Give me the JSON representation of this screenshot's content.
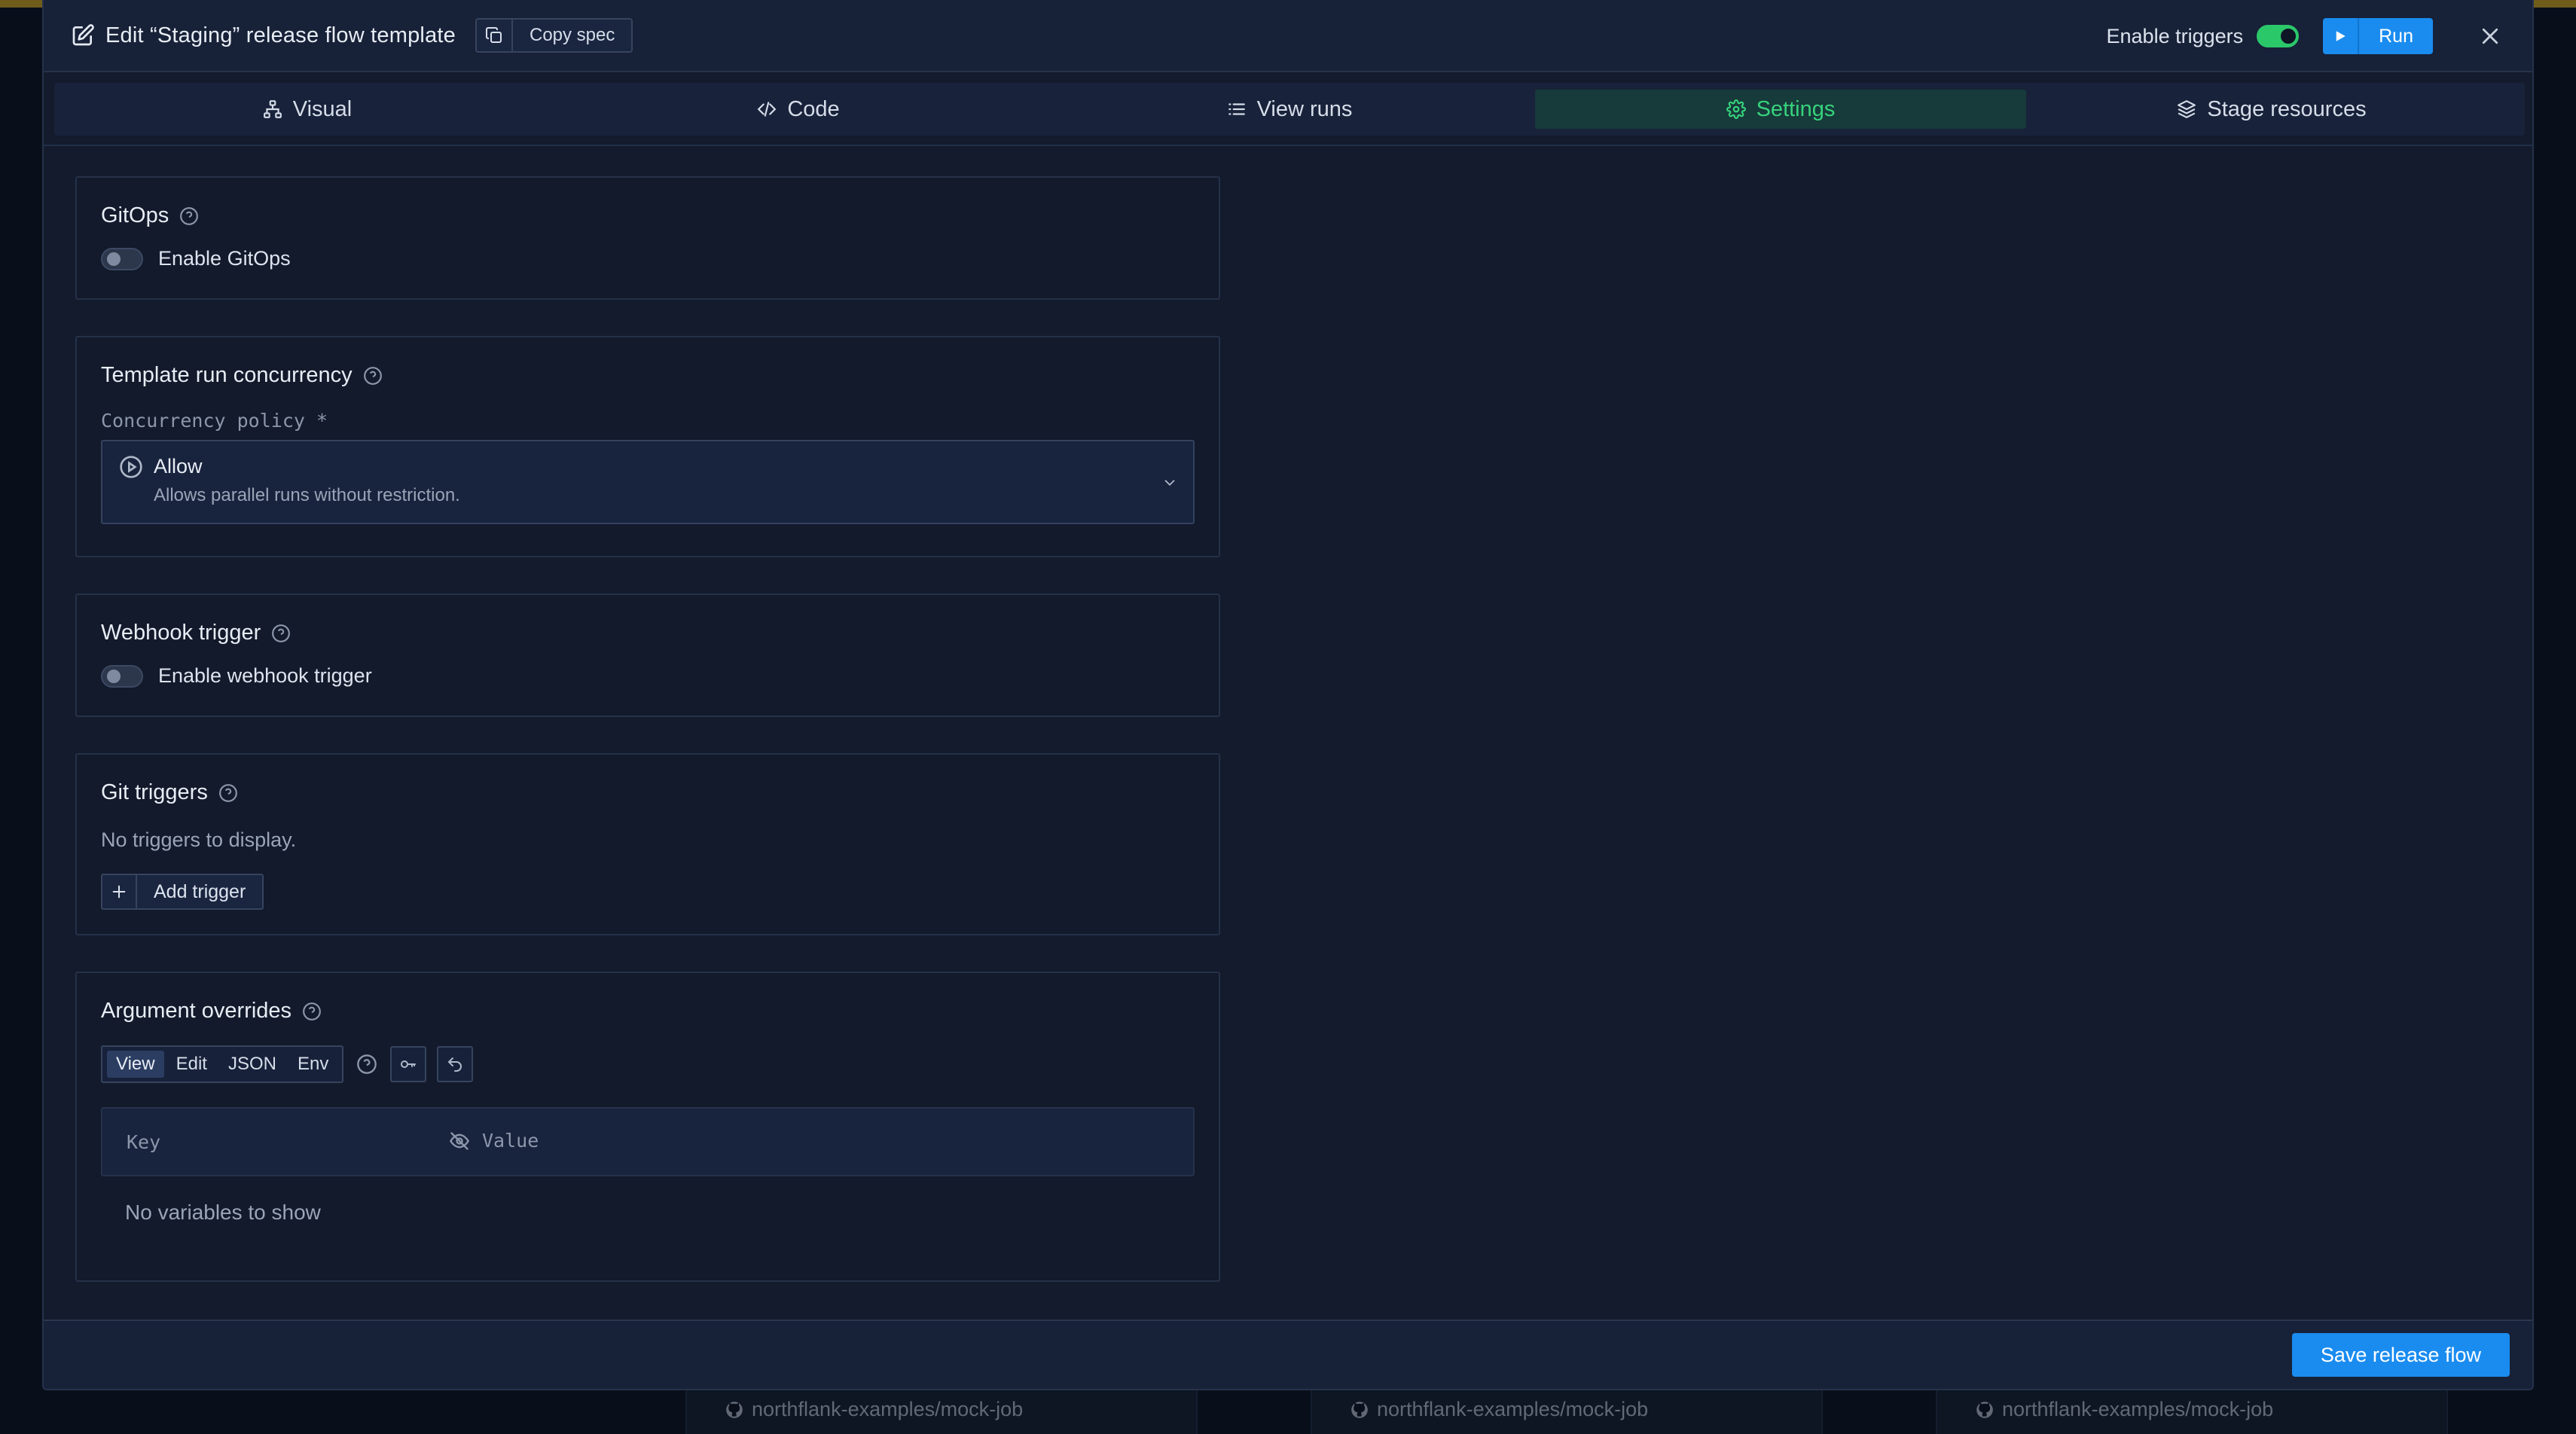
{
  "modal": {
    "title": "Edit “Staging” release flow template",
    "copy_spec_label": "Copy spec",
    "enable_triggers_label": "Enable triggers",
    "enable_triggers_on": true,
    "run_label": "Run"
  },
  "tabs": [
    {
      "label": "Visual",
      "icon": "sitemap-icon",
      "active": false
    },
    {
      "label": "Code",
      "icon": "code-icon",
      "active": false
    },
    {
      "label": "View runs",
      "icon": "list-icon",
      "active": false
    },
    {
      "label": "Settings",
      "icon": "gear-icon",
      "active": true
    },
    {
      "label": "Stage resources",
      "icon": "layers-icon",
      "active": false
    }
  ],
  "gitops": {
    "title": "GitOps",
    "toggle_label": "Enable GitOps",
    "enabled": false
  },
  "concurrency": {
    "title": "Template run concurrency",
    "field_label": "Concurrency policy *",
    "selected_title": "Allow",
    "selected_description": "Allows parallel runs without restriction."
  },
  "webhook": {
    "title": "Webhook trigger",
    "toggle_label": "Enable webhook trigger",
    "enabled": false
  },
  "git_triggers": {
    "title": "Git triggers",
    "empty_text": "No triggers to display.",
    "add_label": "Add trigger"
  },
  "argument_overrides": {
    "title": "Argument overrides",
    "modes": [
      "View",
      "Edit",
      "JSON",
      "Env"
    ],
    "active_mode": "View",
    "key_header": "Key",
    "value_header": "Value",
    "empty_text": "No variables to show"
  },
  "footer": {
    "save_label": "Save release flow"
  },
  "background": {
    "repos": [
      "northflank-examples/mock-job",
      "northflank-examples/mock-job",
      "northflank-examples/mock-job"
    ]
  },
  "colors": {
    "accent": "#1a8cf0",
    "active_tab": "#37d27c",
    "toggle_on": "#2bc86a"
  }
}
